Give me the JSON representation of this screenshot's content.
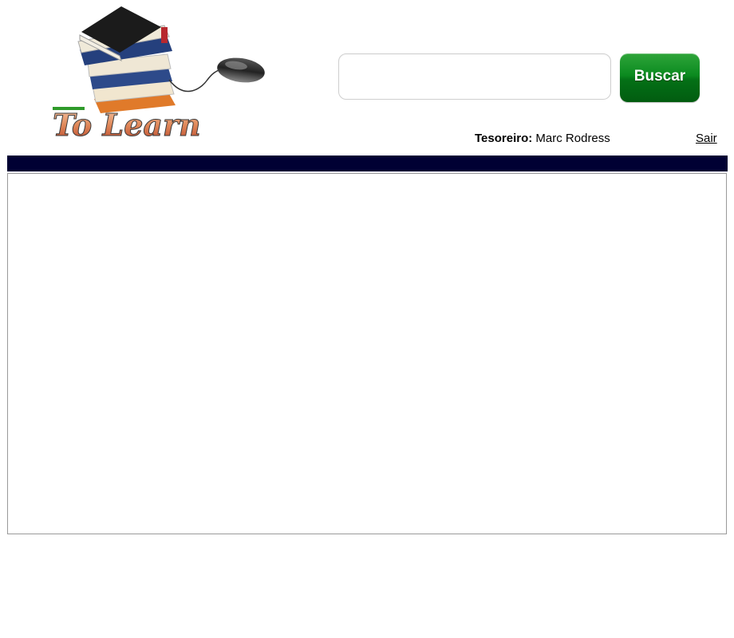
{
  "header": {
    "logo_text": "To Learn",
    "search": {
      "placeholder": "",
      "value": "",
      "button_label": "Buscar"
    },
    "user": {
      "role_label": "Tesoreiro:",
      "name": "Marc Rodress",
      "logout_label": "Sair"
    }
  },
  "colors": {
    "nav_bar": "#000033",
    "search_button": "#0b8a1f",
    "content_border": "#9a9a9a"
  }
}
